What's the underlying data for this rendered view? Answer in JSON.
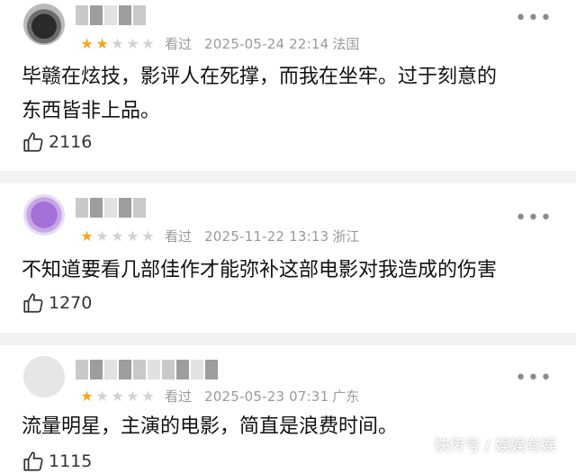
{
  "comments": [
    {
      "stars_filled": 2,
      "stars_total": 5,
      "watched": "看过",
      "date": "2025-05-24 22:14",
      "location": "法国",
      "text_line1": "毕赣在炫技，影评人在死撑，而我在坐牢。过于刻意的",
      "text_line2": "东西皆非上品。",
      "likes": "2116"
    },
    {
      "stars_filled": 1,
      "stars_total": 5,
      "watched": "看过",
      "date": "2025-11-22 13:13",
      "location": "浙江",
      "text_line1": "不知道要看几部佳作才能弥补这部电影对我造成的伤害",
      "likes": "1270"
    },
    {
      "stars_filled": 1,
      "stars_total": 5,
      "watched": "看过",
      "date": "2025-05-23 07:31",
      "location": "广东",
      "text_line1": "流量明星，主演的电影，简直是浪费时间。",
      "likes": "1115"
    }
  ],
  "icons": {
    "like": "thumbs-up-icon",
    "more": "more-dots-icon",
    "star": "star-icon"
  },
  "colors": {
    "star_on": "#f4a623",
    "star_off": "#d2d2d2",
    "meta": "#9a9a9a"
  },
  "watermark": "快传号 / 娱娱有娱"
}
